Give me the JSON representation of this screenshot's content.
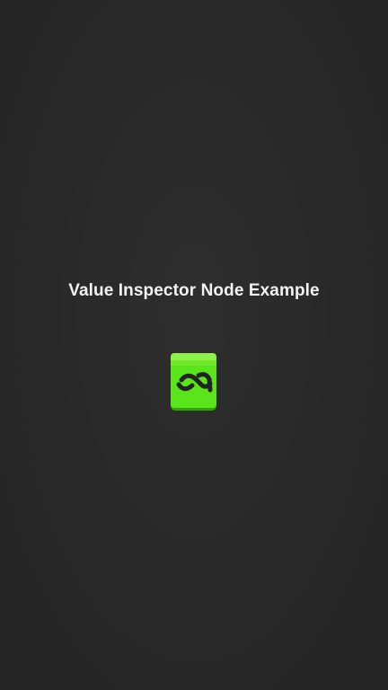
{
  "splash": {
    "title": "Value Inspector Node Example",
    "logo_icon": "link-cube-icon",
    "colors": {
      "background": "#282828",
      "title": "#f2f2f2",
      "logo_green": "#59e51a",
      "logo_dark": "#222222"
    }
  }
}
